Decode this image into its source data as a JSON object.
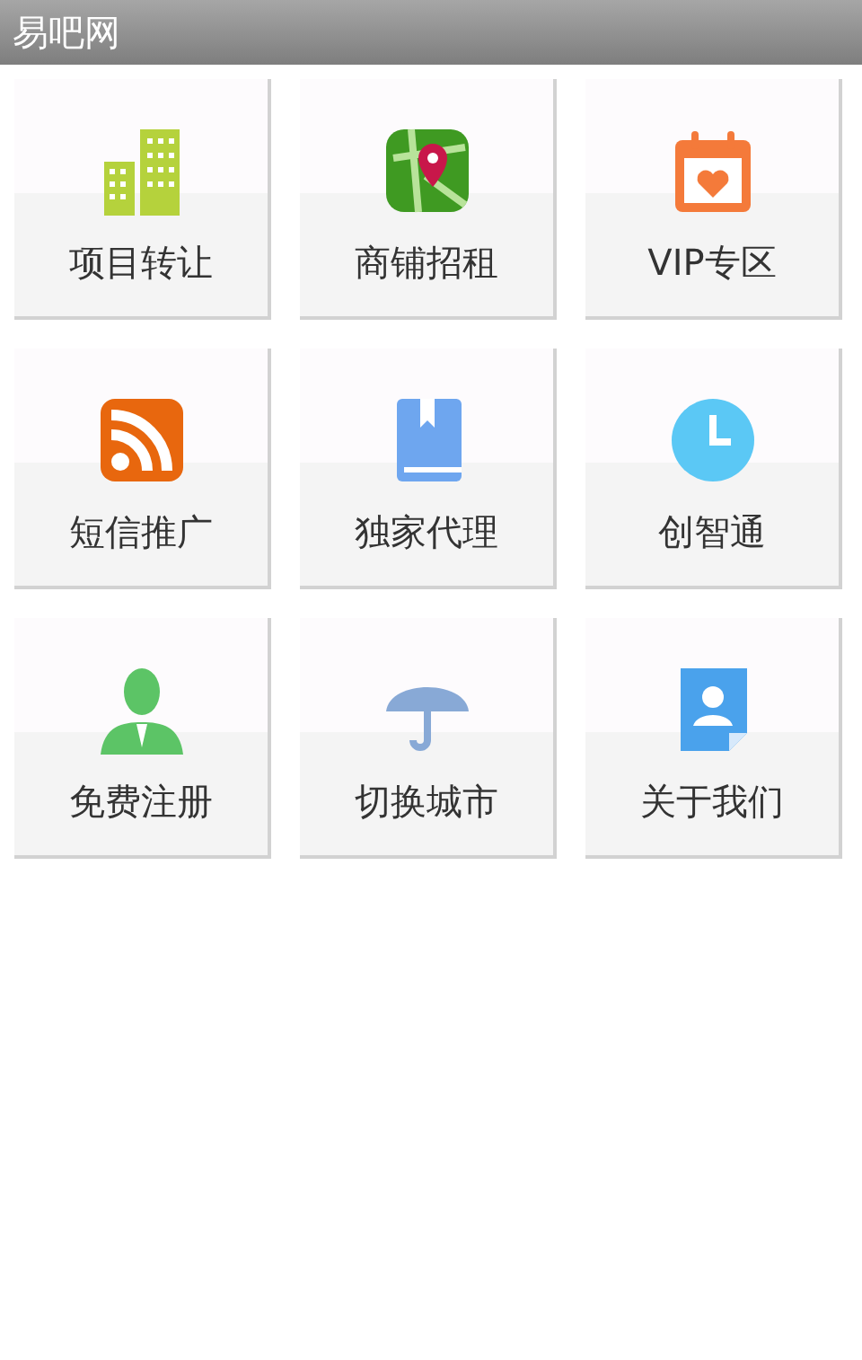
{
  "window": {
    "title": "易吧网"
  },
  "tiles": [
    {
      "label": "项目转让",
      "kind": "buildings"
    },
    {
      "label": "商铺招租",
      "kind": "map"
    },
    {
      "label": "VIP专区",
      "kind": "calendar"
    },
    {
      "label": "短信推广",
      "kind": "rss"
    },
    {
      "label": "独家代理",
      "kind": "book"
    },
    {
      "label": "创智通",
      "kind": "clock"
    },
    {
      "label": "免费注册",
      "kind": "person"
    },
    {
      "label": "切换城市",
      "kind": "umbrella"
    },
    {
      "label": "关于我们",
      "kind": "contact"
    }
  ]
}
